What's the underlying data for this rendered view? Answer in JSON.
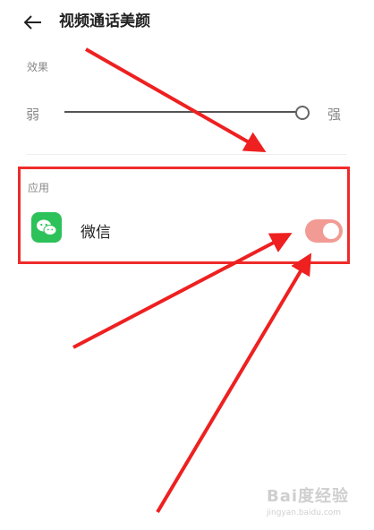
{
  "header": {
    "title": "视频通话美颜"
  },
  "effect": {
    "label": "效果",
    "weak": "弱",
    "strong": "强",
    "level": 1.0
  },
  "apps": {
    "label": "应用",
    "items": [
      {
        "name": "微信",
        "enabled": true
      }
    ]
  },
  "annotation": {
    "box_color": "#ee2b2b",
    "arrow_color": "#ee2020"
  },
  "toggle_color": "#f29b94",
  "watermark": {
    "logo": "Bai度经验",
    "url": "jingyan.baidu.com"
  }
}
